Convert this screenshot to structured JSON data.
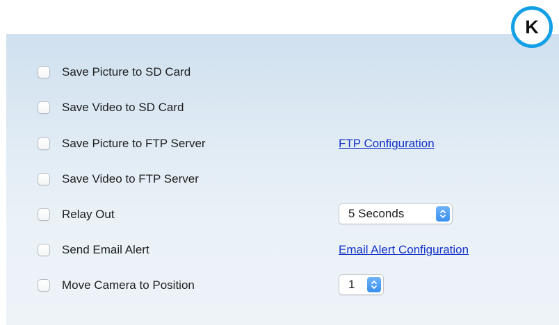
{
  "badge": {
    "letter": "K"
  },
  "options": [
    {
      "label": "Save Picture to SD Card"
    },
    {
      "label": "Save Video to SD Card"
    },
    {
      "label": "Save Picture to FTP Server",
      "link": "FTP Configuration"
    },
    {
      "label": "Save Video to FTP Server"
    },
    {
      "label": "Relay Out",
      "select": {
        "value": "5 Seconds"
      }
    },
    {
      "label": "Send Email Alert",
      "link": "Email Alert Configuration"
    },
    {
      "label": "Move Camera to Position",
      "select": {
        "value": "1"
      }
    }
  ],
  "colors": {
    "link": "#1432c8",
    "badge_ring": "#14a0e6",
    "select_arrow": "#3a8ff0"
  }
}
